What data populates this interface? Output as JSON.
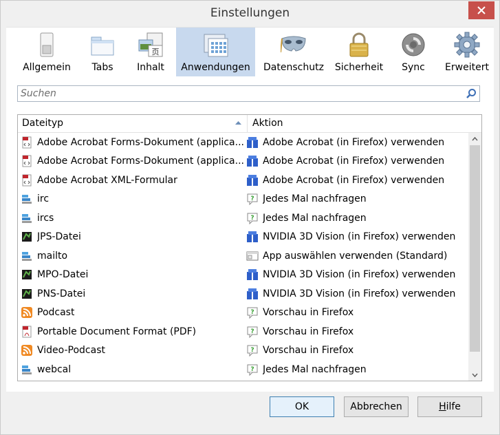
{
  "window": {
    "title": "Einstellungen"
  },
  "toolbar": {
    "items": [
      {
        "label": "Allgemein",
        "icon": "switch-icon"
      },
      {
        "label": "Tabs",
        "icon": "tabs-icon"
      },
      {
        "label": "Inhalt",
        "icon": "content-icon"
      },
      {
        "label": "Anwendungen",
        "icon": "applications-icon",
        "active": true
      },
      {
        "label": "Datenschutz",
        "icon": "mask-icon"
      },
      {
        "label": "Sicherheit",
        "icon": "lock-icon"
      },
      {
        "label": "Sync",
        "icon": "sync-icon"
      },
      {
        "label": "Erweitert",
        "icon": "gear-icon"
      }
    ]
  },
  "search": {
    "placeholder": "Suchen"
  },
  "table": {
    "col_type": "Dateityp",
    "col_action": "Aktion",
    "rows": [
      {
        "type": "Adobe Acrobat Forms-Dokument (applica...",
        "action": "Adobe Acrobat (in Firefox) verwenden"
      },
      {
        "type": "Adobe Acrobat Forms-Dokument (applica...",
        "action": "Adobe Acrobat (in Firefox) verwenden"
      },
      {
        "type": "Adobe Acrobat XML-Formular",
        "action": "Adobe Acrobat (in Firefox) verwenden"
      },
      {
        "type": "irc",
        "action": "Jedes Mal nachfragen"
      },
      {
        "type": "ircs",
        "action": "Jedes Mal nachfragen"
      },
      {
        "type": "JPS-Datei",
        "action": "NVIDIA 3D Vision (in Firefox) verwenden"
      },
      {
        "type": "mailto",
        "action": "App auswählen verwenden (Standard)"
      },
      {
        "type": "MPO-Datei",
        "action": "NVIDIA 3D Vision (in Firefox) verwenden"
      },
      {
        "type": "PNS-Datei",
        "action": "NVIDIA 3D Vision (in Firefox) verwenden"
      },
      {
        "type": "Podcast",
        "action": "Vorschau in Firefox"
      },
      {
        "type": "Portable Document Format (PDF)",
        "action": "Vorschau in Firefox"
      },
      {
        "type": "Video-Podcast",
        "action": "Vorschau in Firefox"
      },
      {
        "type": "webcal",
        "action": "Jedes Mal nachfragen"
      }
    ]
  },
  "buttons": {
    "ok": "OK",
    "cancel": "Abbrechen",
    "help_first": "H",
    "help_rest": "ilfe"
  }
}
